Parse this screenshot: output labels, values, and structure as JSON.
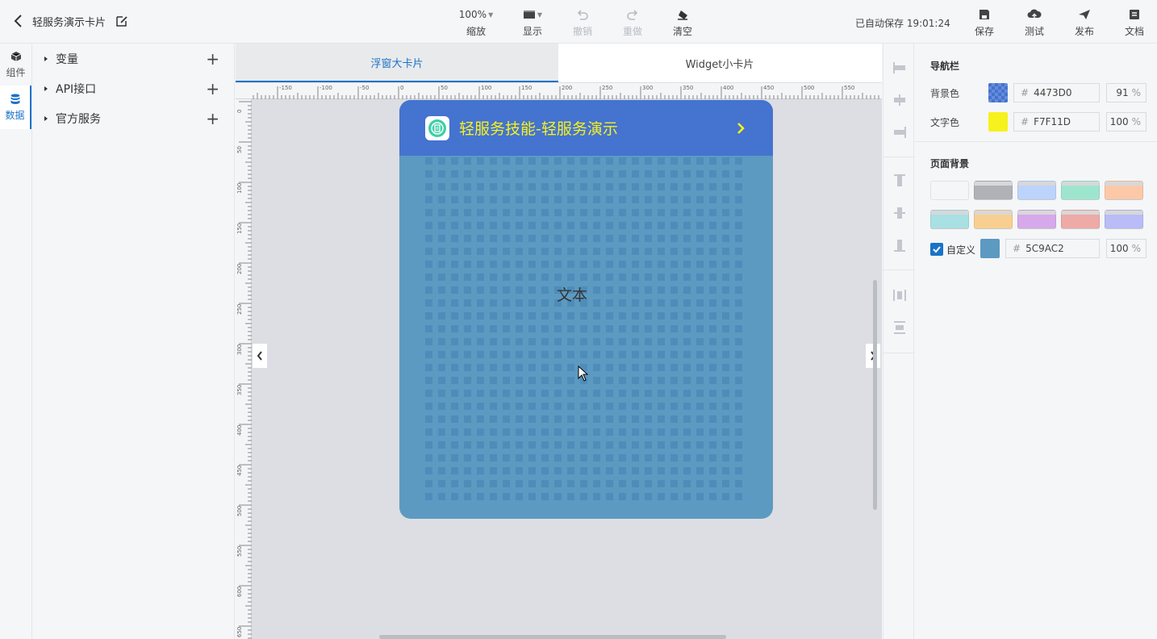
{
  "header": {
    "title": "轻服务演示卡片",
    "zoom": {
      "value": "100%",
      "label": "缩放"
    },
    "display_label": "显示",
    "undo_label": "撤销",
    "redo_label": "重做",
    "clear_label": "清空",
    "autosave": "已自动保存 19:01:24",
    "save_label": "保存",
    "test_label": "测试",
    "publish_label": "发布",
    "docs_label": "文档"
  },
  "rail": {
    "components_label": "组件",
    "data_label": "数据"
  },
  "data_panel": {
    "items": [
      {
        "label": "变量"
      },
      {
        "label": "API接口"
      },
      {
        "label": "官方服务"
      }
    ]
  },
  "canvas": {
    "tabs": [
      {
        "label": "浮窗大卡片",
        "active": true
      },
      {
        "label": "Widget小卡片",
        "active": false
      }
    ],
    "ruler_h": [
      "-150",
      "-100",
      "-50",
      "0",
      "50",
      "100",
      "150",
      "200",
      "250",
      "300",
      "350",
      "400",
      "450",
      "500",
      "550"
    ],
    "ruler_v": [
      "0",
      "50",
      "100",
      "150",
      "200",
      "250",
      "300",
      "350",
      "400",
      "450",
      "500",
      "550",
      "600",
      "650"
    ],
    "card": {
      "title": "轻服务技能-轻服务演示",
      "body_text": "文本",
      "header_color": "#4473D0",
      "title_color": "#F7F11D",
      "body_color": "#5C9AC2"
    }
  },
  "props": {
    "nav_section": "导航栏",
    "bg_color": {
      "label": "背景色",
      "hex": "4473D0",
      "opacity": "91",
      "unit": "%"
    },
    "text_color": {
      "label": "文字色",
      "hex": "F7F11D",
      "opacity": "100",
      "unit": "%"
    },
    "page_bg_section": "页面背景",
    "presets": [
      "#f5f6f8",
      "#b0b2b7",
      "#bcd3fb",
      "#9de6cd",
      "#fcc9a8",
      "#a9e0e3",
      "#f8cf90",
      "#d6a9ea",
      "#eeaaa6",
      "#b9bcf6"
    ],
    "custom": {
      "label": "自定义",
      "checked": true,
      "hex": "5C9AC2",
      "opacity": "100",
      "unit": "%"
    },
    "hash": "#"
  }
}
